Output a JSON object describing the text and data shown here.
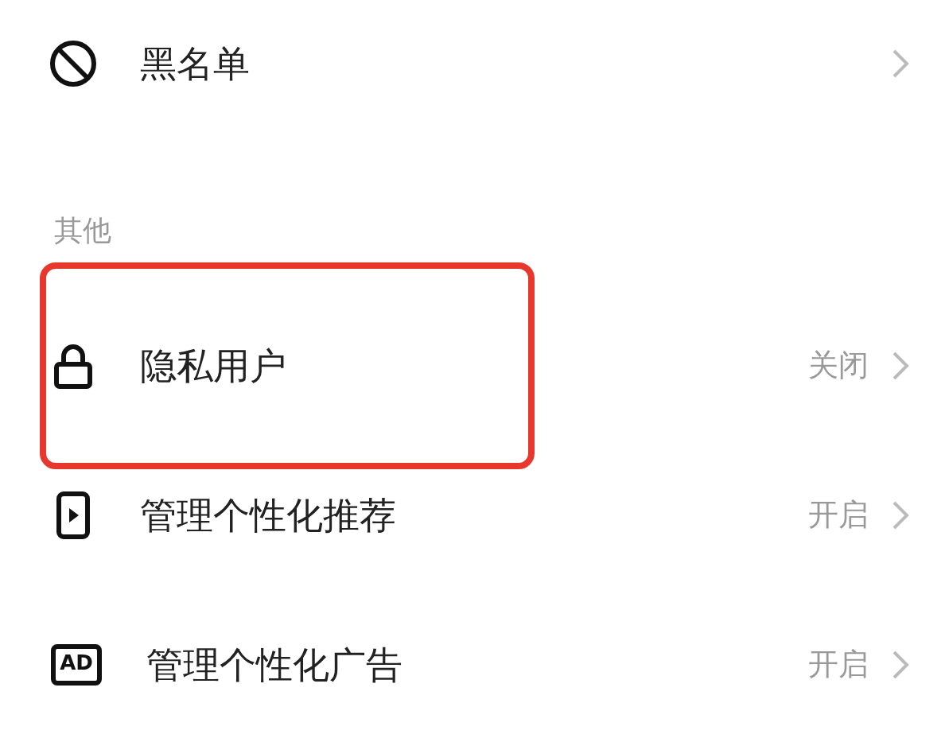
{
  "top_item": {
    "kind": "block",
    "label": "黑名单"
  },
  "section": {
    "title": "其他"
  },
  "items": [
    {
      "kind": "lock",
      "label": "隐私用户",
      "value": "关闭",
      "highlighted": true
    },
    {
      "kind": "phone",
      "label": "管理个性化推荐",
      "value": "开启",
      "highlighted": false
    },
    {
      "kind": "ad",
      "icon_text": "AD",
      "label": "管理个性化广告",
      "value": "开启",
      "highlighted": false
    }
  ]
}
